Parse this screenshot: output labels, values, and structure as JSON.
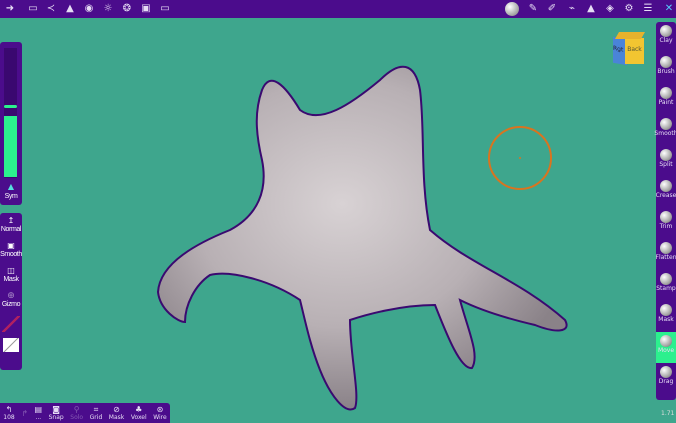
{
  "topbar": {
    "left_icons": [
      "logo-icon",
      "folder-icon",
      "scene-graph-icon",
      "topology-icon",
      "material-icon",
      "light-icon",
      "postprocess-icon",
      "background-image-icon",
      "camera-icon"
    ],
    "right_icons": [
      "matcap-icon",
      "pencil-icon",
      "paint-brush-icon",
      "stroke-icon",
      "symmetry-icon",
      "layers-icon",
      "settings-icon",
      "sliders-icon",
      "help-icon"
    ]
  },
  "gizmo": {
    "faces": [
      "Rgt",
      "Back"
    ]
  },
  "left_panel": {
    "sym_label": "Sym",
    "slider_radius": 0.12,
    "slider_intensity": 0.7,
    "items": [
      {
        "label": "Normal",
        "icon": "arrow-up-icon"
      },
      {
        "label": "Smooth",
        "icon": "smooth-icon"
      },
      {
        "label": "Mask",
        "icon": "mask-icon"
      },
      {
        "label": "Gizmo",
        "icon": "gizmo-icon"
      }
    ]
  },
  "right_tools": [
    {
      "label": "Clay"
    },
    {
      "label": "Brush"
    },
    {
      "label": "Paint"
    },
    {
      "label": "Smooth"
    },
    {
      "label": "Split"
    },
    {
      "label": "Crease"
    },
    {
      "label": "Trim"
    },
    {
      "label": "Flatten"
    },
    {
      "label": "Stamp"
    },
    {
      "label": "Mask"
    },
    {
      "label": "Move",
      "active": true
    },
    {
      "label": "Drag"
    }
  ],
  "bottom_bar": [
    {
      "label": "108",
      "icon": "undo-icon"
    },
    {
      "label": "",
      "icon": "redo-icon",
      "disabled": true
    },
    {
      "label": "...",
      "icon": "layer-icon"
    },
    {
      "label": "Snap",
      "icon": "snap-icon"
    },
    {
      "label": "Solo",
      "icon": "solo-icon",
      "disabled": true
    },
    {
      "label": "Grid",
      "icon": "grid-icon"
    },
    {
      "label": "Mask",
      "icon": "mask-icon"
    },
    {
      "label": "Voxel",
      "icon": "voxel-icon"
    },
    {
      "label": "Wire",
      "icon": "wire-icon"
    }
  ],
  "version": "1.71",
  "colors": {
    "background": "#3ea68d",
    "ui": "#4b0c8c",
    "accent": "#2cf08e",
    "cursor": "#d9741f"
  }
}
